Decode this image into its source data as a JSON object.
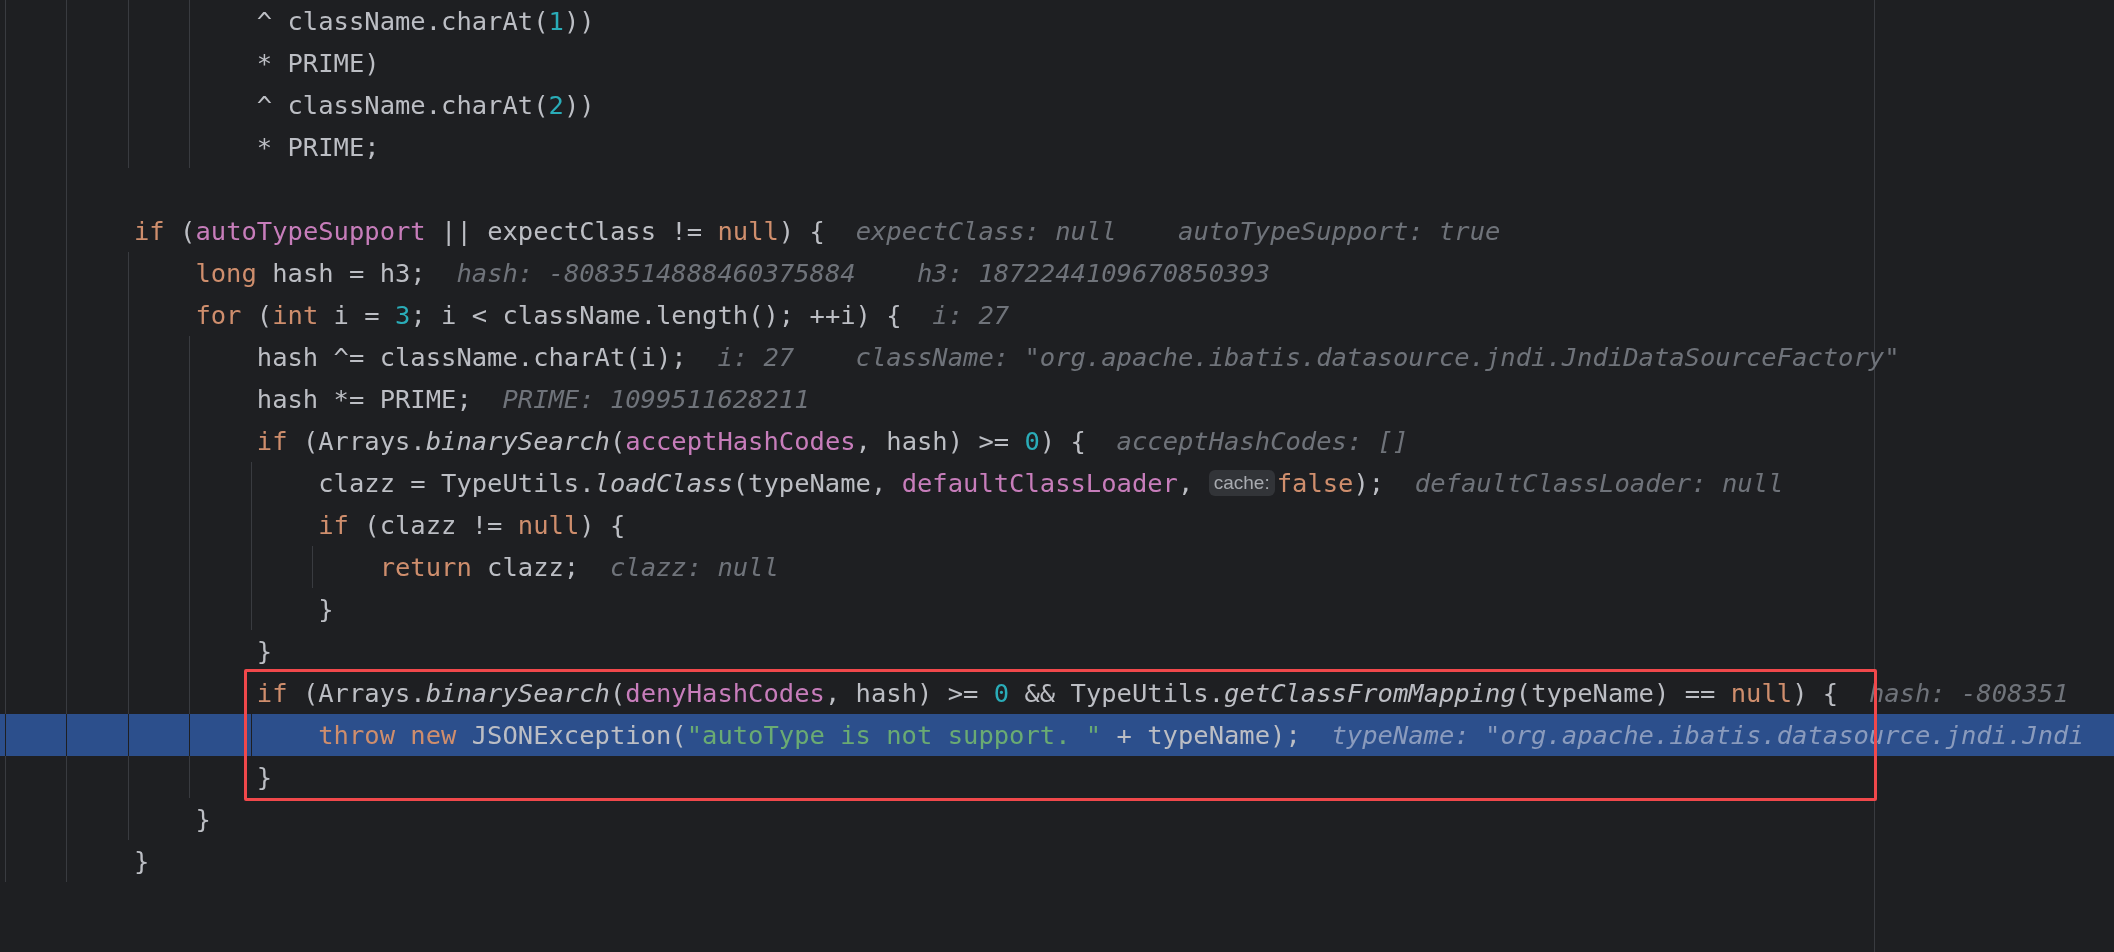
{
  "editor": {
    "lines": [
      {
        "kind": "group",
        "children": [
          {
            "kind": "group",
            "children": [
              {
                "kind": "line",
                "selected": false,
                "tokens": [
                  {
                    "kind": "plain",
                    "text": "^ className.charAt("
                  },
                  {
                    "kind": "number",
                    "text": "1"
                  },
                  {
                    "kind": "plain",
                    "text": "))"
                  }
                ]
              },
              {
                "kind": "line",
                "selected": false,
                "tokens": [
                  {
                    "kind": "plain",
                    "text": "* PRIME)"
                  }
                ]
              },
              {
                "kind": "line",
                "selected": false,
                "tokens": [
                  {
                    "kind": "plain",
                    "text": "^ className.charAt("
                  },
                  {
                    "kind": "number",
                    "text": "2"
                  },
                  {
                    "kind": "plain",
                    "text": "))"
                  }
                ]
              },
              {
                "kind": "line",
                "selected": false,
                "tokens": [
                  {
                    "kind": "plain",
                    "text": "* PRIME;"
                  }
                ]
              }
            ]
          }
        ]
      },
      {
        "kind": "blank"
      },
      {
        "kind": "line",
        "selected": false,
        "tokens": [
          {
            "kind": "keyword",
            "text": "if"
          },
          {
            "kind": "plain",
            "text": " ("
          },
          {
            "kind": "field",
            "text": "autoTypeSupport"
          },
          {
            "kind": "plain",
            "text": " || expectClass != "
          },
          {
            "kind": "keyword",
            "text": "null"
          },
          {
            "kind": "plain",
            "text": ") {"
          }
        ],
        "hints": [
          "expectClass: null",
          "autoTypeSupport: true"
        ],
        "children": [
          {
            "kind": "line",
            "selected": false,
            "tokens": [
              {
                "kind": "keyword",
                "text": "long"
              },
              {
                "kind": "plain",
                "text": " hash = h3;"
              }
            ],
            "hints": [
              "hash: -8083514888460375884",
              "h3: 1872244109670850393"
            ]
          },
          {
            "kind": "line",
            "selected": false,
            "tokens": [
              {
                "kind": "keyword",
                "text": "for"
              },
              {
                "kind": "plain",
                "text": " ("
              },
              {
                "kind": "keyword",
                "text": "int"
              },
              {
                "kind": "plain",
                "text": " i = "
              },
              {
                "kind": "number",
                "text": "3"
              },
              {
                "kind": "plain",
                "text": "; i < className.length(); ++i) {"
              }
            ],
            "hints": [
              "i: 27"
            ],
            "children": [
              {
                "kind": "line",
                "selected": false,
                "tokens": [
                  {
                    "kind": "plain",
                    "text": "hash ^= className.charAt(i);"
                  }
                ],
                "hints": [
                  "i: 27",
                  "className: \"org.apache.ibatis.datasource.jndi.JndiDataSourceFactory\""
                ]
              },
              {
                "kind": "line",
                "selected": false,
                "tokens": [
                  {
                    "kind": "plain",
                    "text": "hash *= PRIME;"
                  }
                ],
                "hints": [
                  "PRIME: 1099511628211"
                ]
              },
              {
                "kind": "line",
                "selected": false,
                "tokens": [
                  {
                    "kind": "keyword",
                    "text": "if"
                  },
                  {
                    "kind": "plain",
                    "text": " (Arrays."
                  },
                  {
                    "kind": "method",
                    "text": "binarySearch"
                  },
                  {
                    "kind": "plain",
                    "text": "("
                  },
                  {
                    "kind": "field",
                    "text": "acceptHashCodes"
                  },
                  {
                    "kind": "plain",
                    "text": ", hash) >= "
                  },
                  {
                    "kind": "number",
                    "text": "0"
                  },
                  {
                    "kind": "plain",
                    "text": ") {"
                  }
                ],
                "hints": [
                  "acceptHashCodes: []"
                ],
                "children": [
                  {
                    "kind": "line",
                    "selected": false,
                    "tokens": [
                      {
                        "kind": "plain",
                        "text": "clazz = TypeUtils."
                      },
                      {
                        "kind": "method",
                        "text": "loadClass"
                      },
                      {
                        "kind": "plain",
                        "text": "(typeName, "
                      },
                      {
                        "kind": "field",
                        "text": "defaultClassLoader"
                      },
                      {
                        "kind": "plain",
                        "text": ", "
                      },
                      {
                        "kind": "param_hint",
                        "text": "cache:"
                      },
                      {
                        "kind": "keyword",
                        "text": "false"
                      },
                      {
                        "kind": "plain",
                        "text": ");"
                      }
                    ],
                    "hints": [
                      "defaultClassLoader: null"
                    ]
                  },
                  {
                    "kind": "line",
                    "selected": false,
                    "tokens": [
                      {
                        "kind": "keyword",
                        "text": "if"
                      },
                      {
                        "kind": "plain",
                        "text": " (clazz != "
                      },
                      {
                        "kind": "keyword",
                        "text": "null"
                      },
                      {
                        "kind": "plain",
                        "text": ") {"
                      }
                    ],
                    "children": [
                      {
                        "kind": "line",
                        "selected": false,
                        "tokens": [
                          {
                            "kind": "keyword",
                            "text": "return"
                          },
                          {
                            "kind": "plain",
                            "text": " clazz;"
                          }
                        ],
                        "hints": [
                          "clazz: null"
                        ]
                      }
                    ]
                  },
                  {
                    "kind": "line",
                    "selected": false,
                    "tokens": [
                      {
                        "kind": "plain",
                        "text": "}"
                      }
                    ]
                  }
                ]
              },
              {
                "kind": "line",
                "selected": false,
                "tokens": [
                  {
                    "kind": "plain",
                    "text": "}"
                  }
                ]
              },
              {
                "kind": "box",
                "children": [
                  {
                    "kind": "line",
                    "selected": false,
                    "tokens": [
                      {
                        "kind": "keyword",
                        "text": "if"
                      },
                      {
                        "kind": "plain",
                        "text": " (Arrays."
                      },
                      {
                        "kind": "method",
                        "text": "binarySearch"
                      },
                      {
                        "kind": "plain",
                        "text": "("
                      },
                      {
                        "kind": "field",
                        "text": "denyHashCodes"
                      },
                      {
                        "kind": "plain",
                        "text": ", hash) >= "
                      },
                      {
                        "kind": "number",
                        "text": "0"
                      },
                      {
                        "kind": "plain",
                        "text": " && TypeUtils."
                      },
                      {
                        "kind": "method",
                        "text": "getClassFromMapping"
                      },
                      {
                        "kind": "plain",
                        "text": "(typeName) == "
                      },
                      {
                        "kind": "keyword",
                        "text": "null"
                      },
                      {
                        "kind": "plain",
                        "text": ") {"
                      }
                    ],
                    "hints": [
                      "hash: -808351"
                    ],
                    "children": [
                      {
                        "kind": "line",
                        "selected": true,
                        "tokens": [
                          {
                            "kind": "keyword",
                            "text": "throw new"
                          },
                          {
                            "kind": "plain",
                            "text": " JSONException("
                          },
                          {
                            "kind": "string",
                            "text": "\"autoType is not support. \""
                          },
                          {
                            "kind": "plain",
                            "text": " + typeName);"
                          }
                        ],
                        "hints": [
                          "typeName: \"org.apache.ibatis.datasource.jndi.Jndi"
                        ]
                      }
                    ]
                  },
                  {
                    "kind": "line",
                    "selected": false,
                    "tokens": [
                      {
                        "kind": "plain",
                        "text": "}"
                      }
                    ]
                  }
                ]
              }
            ]
          },
          {
            "kind": "line",
            "selected": false,
            "tokens": [
              {
                "kind": "plain",
                "text": "}"
              }
            ]
          }
        ]
      },
      {
        "kind": "line",
        "selected": false,
        "tokens": [
          {
            "kind": "plain",
            "text": "}"
          }
        ]
      }
    ]
  }
}
